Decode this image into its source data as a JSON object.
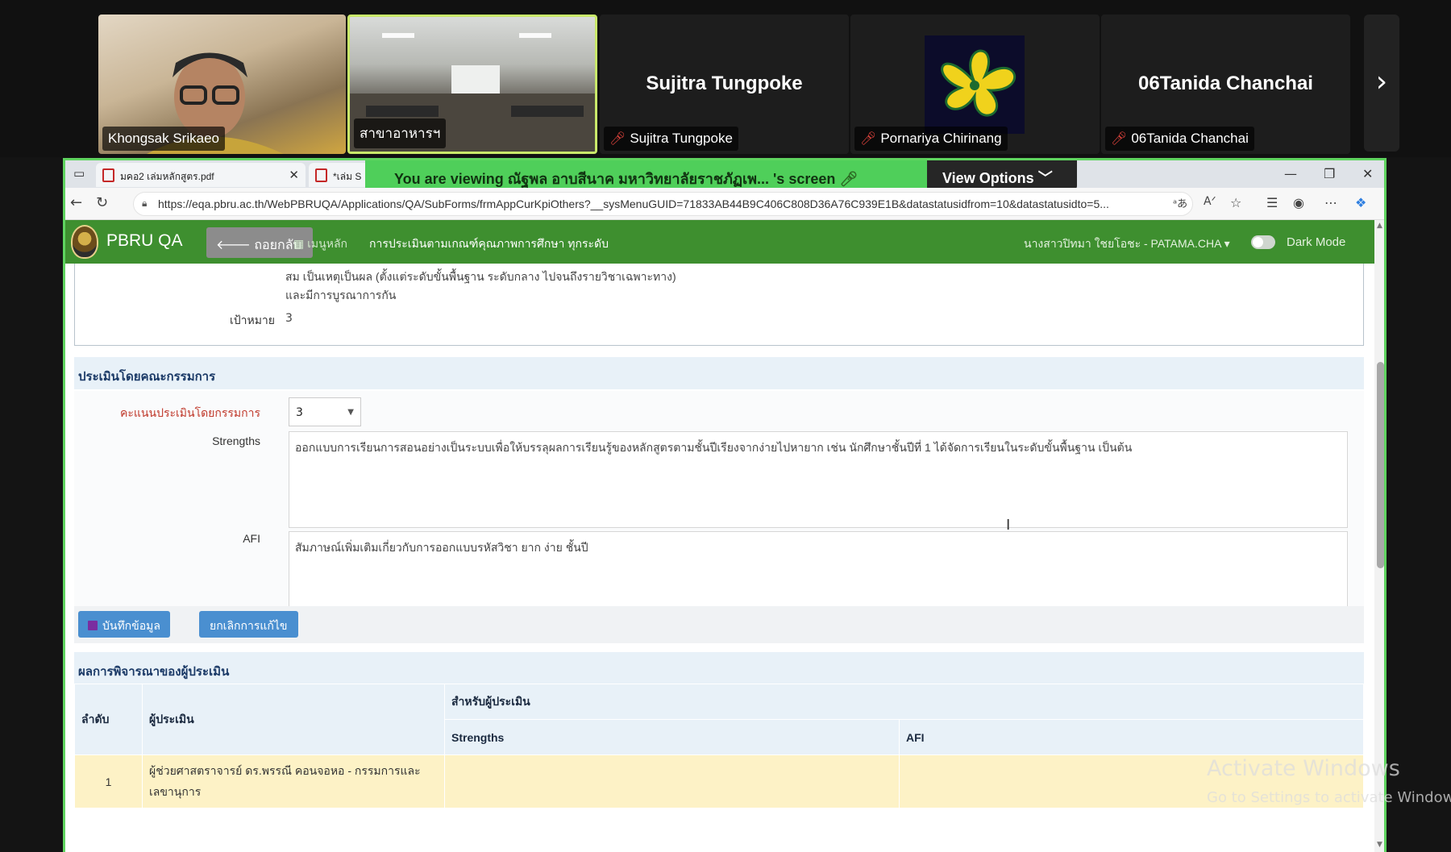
{
  "participants": [
    {
      "name": "Khongsak Srikaeo",
      "muted": false
    },
    {
      "name": "สาขาอาหารฯ",
      "muted": false
    },
    {
      "name": "Sujitra Tungpoke",
      "muted": true
    },
    {
      "name": "Pornariya Chirinang",
      "muted": true
    },
    {
      "name": "06Tanida Chanchai",
      "muted": true
    }
  ],
  "participant_big_names": {
    "sujitra": "Sujitra Tungpoke",
    "tanida": "06Tanida Chanchai"
  },
  "share_banner": {
    "viewing_text": "You are viewing  ณัฐพล อาบสีนาค มหาวิทยาลัยราชภัฏเพ... 's screen",
    "view_options": "View Options"
  },
  "browser": {
    "tabs": [
      {
        "title": "มคอ2 เล่มหลักสูตร.pdf"
      },
      {
        "title": "*เล่ม S"
      }
    ],
    "url": "https://eqa.pbru.ac.th/WebPBRUQA/Applications/QA/SubForms/frmAppCurKpiOthers?__sysMenuGUID=71833AB44B9C406C808D36A76C939E1B&datastatusidfrom=10&datastatusidto=5..."
  },
  "app": {
    "brand": "PBRU QA",
    "back_label": "ถอยกลับ",
    "menu_main": "เมนูหลัก",
    "breadcrumb": "การประเมินตามเกณฑ์คุณภาพการศึกษา ทุกระดับ",
    "user": "นางสาวปิทมา ใชยโอชะ - PATAMA.CHA",
    "dark_mode": "Dark Mode"
  },
  "kpi": {
    "desc_line1": "สม เป็นเหตุเป็นผล (ตั้งแต่ระดับขั้นพื้นฐาน ระดับกลาง ไปจนถึงรายวิชาเฉพาะทาง)",
    "desc_line2": "และมีการบูรณาการกัน",
    "target_label": "เป้าหมาย",
    "target_value": "3"
  },
  "committee": {
    "section_title": "ประเมินโดยคณะกรรมการ",
    "score_label": "คะแนนประเมินโดยกรรมการ",
    "score_value": "3",
    "strengths_label": "Strengths",
    "strengths_text": "ออกแบบการเรียนการสอนอย่างเป็นระบบเพื่อให้บรรลุผลการเรียนรู้ของหลักสูตรตามชั้นปีเรียงจากง่ายไปหายาก  เช่น นักศึกษาชั้นปีที่ 1 ได้จัดการเรียนในระดับขั้นพื้นฐาน เป็นต้น",
    "afi_label": "AFI",
    "afi_text": "สัมภาษณ์เพิ่มเติมเกี่ยวกับการออกแบบรหัสวิชา ยาก ง่าย ชั้นปี",
    "save_label": "บันทึกข้อมูล",
    "cancel_label": "ยกเลิกการแก้ไข"
  },
  "results": {
    "section_title": "ผลการพิจารณาของผู้ประเมิน",
    "col_no": "ลำดับ",
    "col_evaluator": "ผู้ประเมิน",
    "col_group": "สำหรับผู้ประเมิน",
    "col_strengths": "Strengths",
    "col_afi": "AFI",
    "rows": [
      {
        "no": "1",
        "evaluator_line1": "ผู้ช่วยศาสตราจารย์ ดร.พรรณี คอนจอหอ - กรรมการและ",
        "evaluator_line2": "เลขานุการ",
        "strengths": "",
        "afi": ""
      }
    ]
  },
  "watermark": {
    "line1": "Activate Windows",
    "line2": "Go to Settings to activate Windows."
  }
}
